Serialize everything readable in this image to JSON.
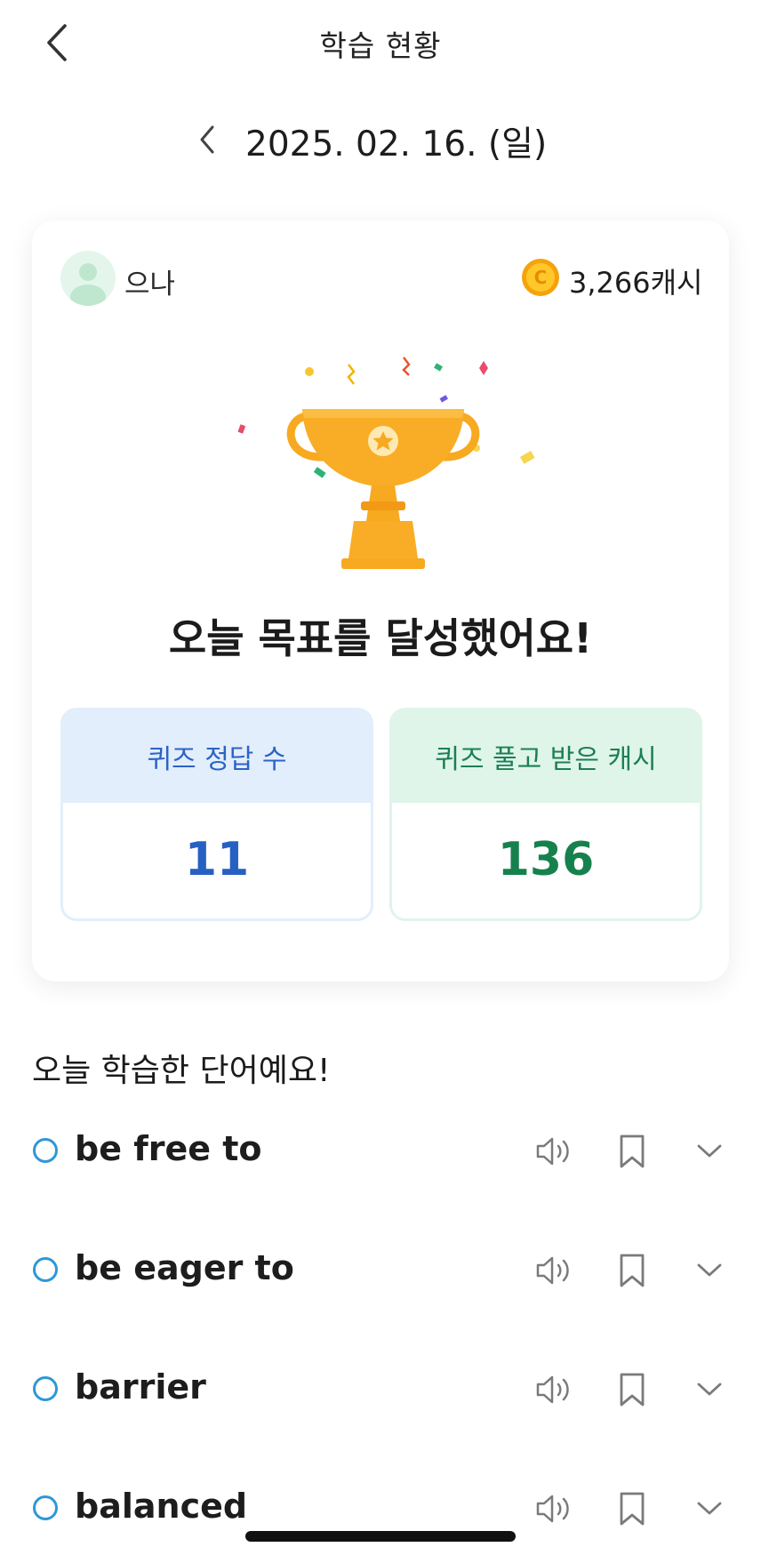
{
  "header": {
    "title": "학습 현황"
  },
  "date": {
    "label": "2025. 02. 16. (일)"
  },
  "card": {
    "user_name": "으나",
    "cash": "3,266캐시",
    "goal_message": "오늘 목표를 달성했어요!",
    "stats": [
      {
        "label": "퀴즈 정답 수",
        "value": "11"
      },
      {
        "label": "퀴즈 풀고 받은 캐시",
        "value": "136"
      }
    ]
  },
  "words_section": {
    "title": "오늘 학습한 단어예요!",
    "words": [
      {
        "text": "be free to"
      },
      {
        "text": "be eager to"
      },
      {
        "text": "barrier"
      },
      {
        "text": "balanced"
      }
    ]
  },
  "colors": {
    "accent_blue": "#2660c2",
    "accent_green": "#16814d",
    "check_blue": "#2f97d7",
    "trophy_gold": "#f7a920"
  },
  "icons": {
    "back": "chevron-left-icon",
    "speaker": "speaker-icon",
    "bookmark": "bookmark-icon",
    "expand": "chevron-down-icon",
    "coin": "coin-icon",
    "trophy": "trophy-icon"
  }
}
